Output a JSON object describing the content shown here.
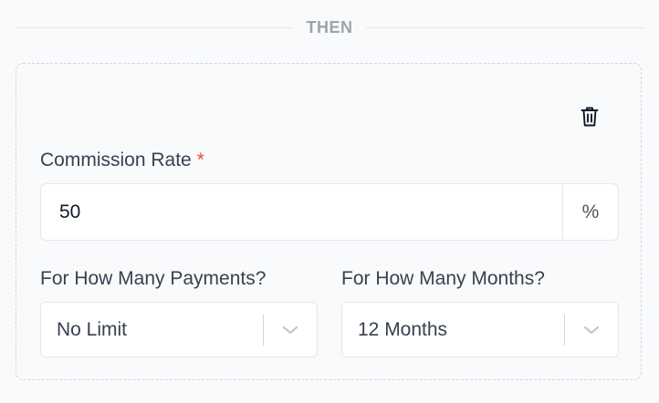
{
  "divider": {
    "label": "THEN"
  },
  "actions": {
    "delete_icon": "trash-icon"
  },
  "commission_rate": {
    "label": "Commission Rate",
    "required_marker": "*",
    "value": "50",
    "suffix": "%"
  },
  "payments": {
    "label": "For How Many Payments?",
    "selected": "No Limit",
    "icon": "chevron-down-icon"
  },
  "months": {
    "label": "For How Many Months?",
    "selected": "12 Months",
    "icon": "chevron-down-icon"
  },
  "colors": {
    "required": "#ef4444",
    "border": "#e5e7eb",
    "background": "#f9fafb"
  }
}
